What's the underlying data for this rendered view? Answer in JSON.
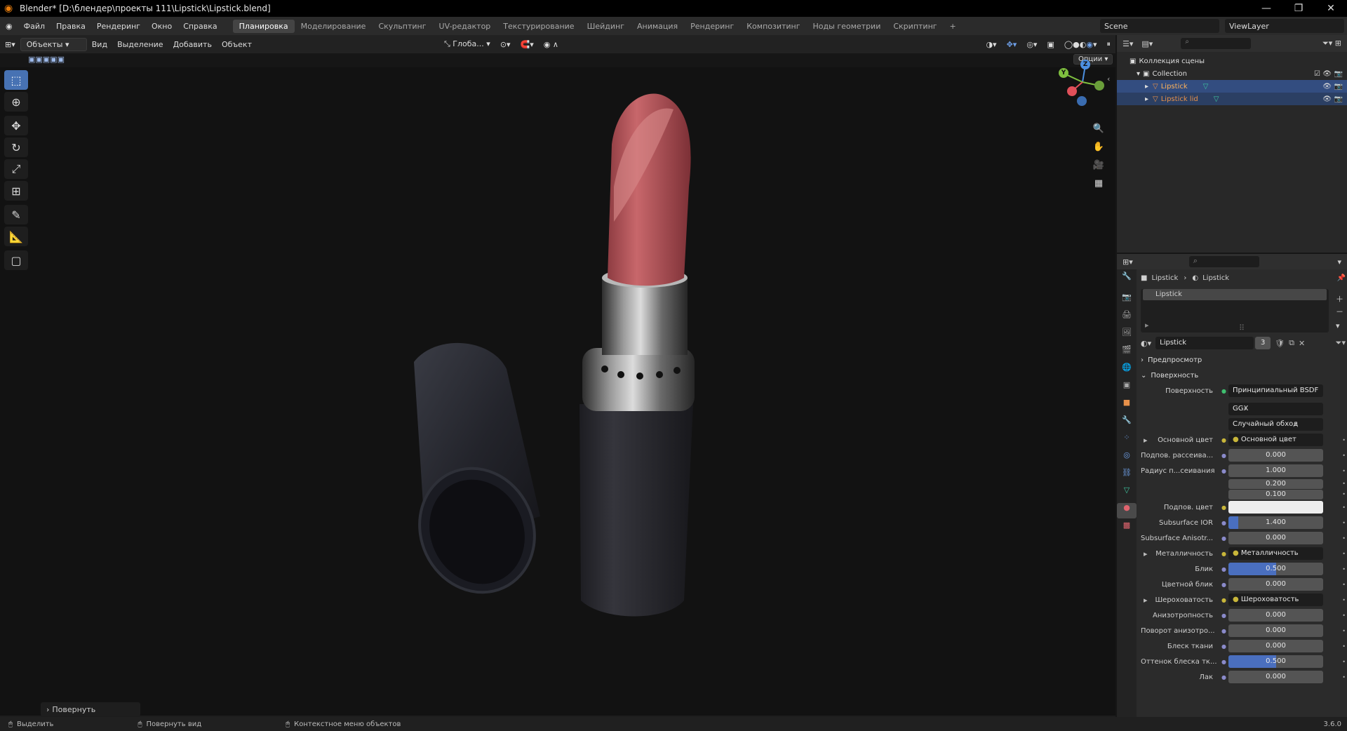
{
  "window": {
    "title": "Blender* [D:\\блендер\\проекты 111\\Lipstick\\Lipstick.blend]"
  },
  "menu": {
    "items": [
      "Файл",
      "Правка",
      "Рендеринг",
      "Окно",
      "Справка"
    ],
    "workspaces": [
      "Планировка",
      "Моделирование",
      "Скульптинг",
      "UV-редактор",
      "Текстурирование",
      "Шейдинг",
      "Анимация",
      "Рендеринг",
      "Композитинг",
      "Ноды геометрии",
      "Скриптинг"
    ],
    "add_tab": "+",
    "scene": "Scene",
    "view_layer": "ViewLayer"
  },
  "viewport_header": {
    "mode": "Объекты",
    "menu": [
      "Вид",
      "Выделение",
      "Добавить",
      "Объект"
    ],
    "transform": "Глоба...",
    "options": "Опции"
  },
  "gizmo": {
    "x": "X",
    "y": "Y",
    "z": "Z"
  },
  "last_op": "Повернуть",
  "outliner": {
    "scene_collection": "Коллекция сцены",
    "collection": "Collection",
    "objects": [
      "Lipstick",
      "Lipstick lid"
    ]
  },
  "properties": {
    "breadcrumb": [
      "Lipstick",
      "Lipstick"
    ],
    "slot": "Lipstick",
    "material": "Lipstick",
    "users": "3",
    "sections": {
      "preview": "Предпросмотр",
      "surface": "Поверхность"
    },
    "surface_label": "Поверхность",
    "surface_value": "Принципиальный BSDF",
    "distribution": "GGX",
    "subsurface_method": "Случайный обход",
    "params": [
      {
        "label": "Основной цвет",
        "value": "Основной цвет",
        "kind": "link"
      },
      {
        "label": "Подпов. рассеива...",
        "value": "0.000",
        "kind": "num"
      },
      {
        "label": "Радиус п...сеивания",
        "value": "1.000",
        "kind": "num"
      },
      {
        "label": "",
        "value": "0.200",
        "kind": "num"
      },
      {
        "label": "",
        "value": "0.100",
        "kind": "num"
      },
      {
        "label": "Подпов. цвет",
        "value": "",
        "kind": "color"
      },
      {
        "label": "Subsurface IOR",
        "value": "1.400",
        "kind": "num",
        "fill": 0.1
      },
      {
        "label": "Subsurface Anisotr...",
        "value": "0.000",
        "kind": "num"
      },
      {
        "label": "Металличность",
        "value": "Металличность",
        "kind": "link"
      },
      {
        "label": "Блик",
        "value": "0.500",
        "kind": "num",
        "fill": 0.5
      },
      {
        "label": "Цветной блик",
        "value": "0.000",
        "kind": "num"
      },
      {
        "label": "Шероховатость",
        "value": "Шероховатость",
        "kind": "link"
      },
      {
        "label": "Анизотропность",
        "value": "0.000",
        "kind": "num"
      },
      {
        "label": "Поворот анизотро...",
        "value": "0.000",
        "kind": "num"
      },
      {
        "label": "Блеск ткани",
        "value": "0.000",
        "kind": "num"
      },
      {
        "label": "Оттенок блеска тк...",
        "value": "0.500",
        "kind": "num",
        "fill": 0.5
      },
      {
        "label": "Лак",
        "value": "0.000",
        "kind": "num"
      }
    ]
  },
  "status": {
    "select": "Выделить",
    "rotate_view": "Повернуть вид",
    "context_menu": "Контекстное меню объектов",
    "version": "3.6.0"
  },
  "colors": {
    "accent": "#4772b3",
    "lipstick": "#b85a5e",
    "tube": "#2a2a2f"
  }
}
